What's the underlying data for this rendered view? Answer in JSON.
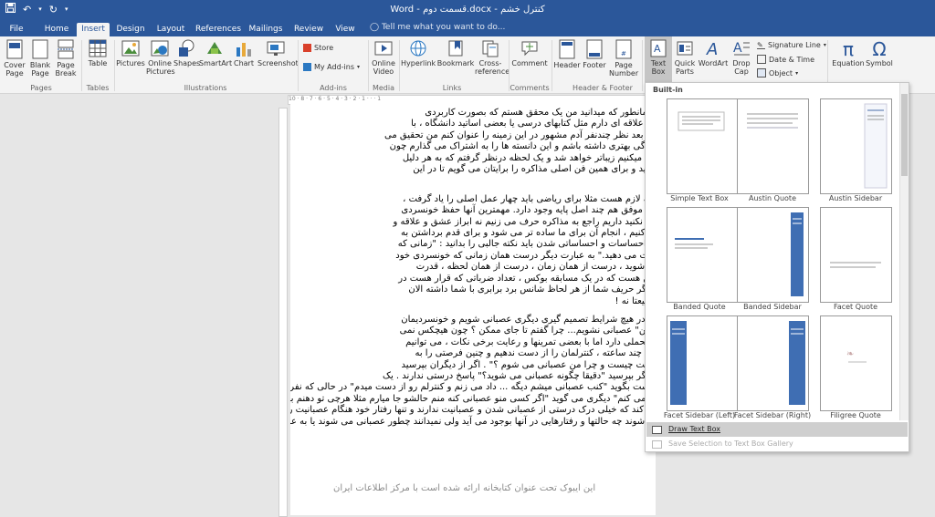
{
  "title": "Word - قسمت دوم.docx - کنترل خشم",
  "quick_access": {
    "save_icon": "save-icon",
    "undo_icon": "undo-icon",
    "redo_icon": "redo-icon",
    "customize_icon": "customize-icon"
  },
  "tabs": [
    "File",
    "Home",
    "Insert",
    "Design",
    "Layout",
    "References",
    "Mailings",
    "Review",
    "View"
  ],
  "active_tab": "Insert",
  "tell_me": "Tell me what you want to do...",
  "ribbon": {
    "pages": {
      "cover": "Cover\nPage",
      "blank": "Blank\nPage",
      "break": "Page\nBreak",
      "label": "Pages"
    },
    "tables": {
      "table": "Table",
      "label": "Tables"
    },
    "illustrations": {
      "pictures": "Pictures",
      "online": "Online\nPictures",
      "shapes": "Shapes",
      "smartart": "SmartArt",
      "chart": "Chart",
      "screenshot": "Screenshot",
      "label": "Illustrations"
    },
    "addins": {
      "store": "Store",
      "myaddins": "My Add-ins",
      "label": "Add-ins"
    },
    "media": {
      "video": "Online\nVideo",
      "label": "Media"
    },
    "links": {
      "hyperlink": "Hyperlink",
      "bookmark": "Bookmark",
      "crossref": "Cross-\nreference",
      "label": "Links"
    },
    "comments": {
      "comment": "Comment",
      "label": "Comments"
    },
    "headerfooter": {
      "header": "Header",
      "footer": "Footer",
      "pagenum": "Page\nNumber",
      "label": "Header & Footer"
    },
    "text": {
      "textbox": "Text\nBox",
      "quickparts": "Quick\nParts",
      "wordart": "WordArt",
      "dropcap": "Drop\nCap",
      "sigline": "Signature Line",
      "datetime": "Date & Time",
      "object": "Object"
    },
    "symbols": {
      "equation": "Equation",
      "symbol": "Symbol"
    }
  },
  "ruler_text": "10 · 8 · 7 · 6 · 5 · 4 · 3 · 2 · 1 · · · 1",
  "document_lines": [
    "کردم ولی همانطور که میدانید من یک محقق هستم که بصورت کاربردی",
    "ق می کنم و علاقه ای دارم مثل کتابهای درسی یا بعضی اساتید دانشگاه ، با",
    "شروع کنم و بعد نظر چندنفر آدم مشهور در این زمینه را عنوان کنم من تحقیق می",
    "ده کنم و زندگی بهتری داشته باشم و این دانسته ها را به اشتراک می گذارم چون",
    "در آن زندگی میکنیم زیباتر خواهد شد و یک لحظه درنظر گرفتم که به هر دلیل",
    "ا بعدها بخوانید و برای همین فن اصلی مذاکره را برایتان می گویم تا در این",
    "ند.",
    "",
    "مهارتهای پایه لازم هست مثلا برای ریاضی باید چهار عمل اصلی را یاد گرفت ،",
    "برای مذاکره موفق هم چند اصل پایه وجود دارد. مهمترین آنها حفظ خونسردی",
    "ید (فراموش نکنید داریم راجع به مذاکره حرف می زنیم نه ابراز عشق و علاقه و",
    "ی را رعایت کنیم ، انجام آن برای ما ساده تر می شود و برای قدم برداشتن به",
    "کنترلمان بر احساسات و احساساتی شدن باید نکته جالبی را بدانید : \"زمانی که",
    "ان را از دست می دهید.\" به عبارت دیگر درست همان زمانی که خونسردی خود",
    "عصبانی می شوید ، درست از همان زمان ، درست از همان لحظه ، قدرت",
    "ست مثل این هست که در یک مسابقه بوکس ، تعداد ضرباتی که قرار هست در",
    "این صورت اگر حریف شما از هر لحاظ شانس برد برابری با شما داشته الان",
    "رخ دهد ؟ طبیعتا نه !",
    "",
    "مذاکره و نه در هیچ شرایط تصمیم گیری دیگری عصبانی شویم و خونسردیمان",
    "\"تا جای ممکن\" عصبانی نشویم... چرا گفتم تا جای ممکن ؟ چون هیچکس نمی",
    "سی آستانه تحملی دارد اما با بعضی تمرینها و رعایت برخی نکات ، می توانیم",
    "ر یک مذاکره چند ساعته ، کنترلمان را از دست ندهیم و چنین فرصتی را به",
    "کنیم \"عصبانیت چیست و چرا من عصبانی می شوم ؟\" . اگر از دیگران بپرسید",
    "طلب افراد اگر بپرسید \"دقیقا چگونه عصبانی می شوید؟\" پاسخ درستی ندارند . یک",
    "نفر ممکن است بگوید \"کنب عصبانی میشم دیگه ... داد می زنم و کنترلم رو از دست میدم\" در حالی که نفر بعدی می گوید \"می زنم و",
    "طرفم را له می کنم\" دیگری می گوید \"اگر کسی منو عصبانی کنه منم حالشو جا میارم مثلا هرچی تو دهنم بهش میگم\" و تمام اینها",
    "مشخص می کند که خیلی درک درستی از عصبانی شدن و عصبانیت ندارند و تنها رفتار خود هنگام عصبانیت را بیان می کنند",
    "عصبانی می شوند چه حالتها و رفتارهایی در آنها بوجود می آید ولی نمیدانند چطور عصبانی می شوند یا به عبارتی چه چیزی باعث"
  ],
  "watermark": "این ایبوک تحت عنوان کتابخانه ارائه شده است با مرکز اطلاعات ایران",
  "gallery": {
    "header": "Built-in",
    "items": [
      "Simple Text Box",
      "Austin Quote",
      "Austin Sidebar",
      "Banded Quote",
      "Banded Sidebar",
      "Facet Quote",
      "Facet Sidebar (Left)",
      "Facet Sidebar (Right)",
      "Filigree Quote"
    ],
    "draw": "Draw Text Box",
    "save": "Save Selection to Text Box Gallery"
  }
}
